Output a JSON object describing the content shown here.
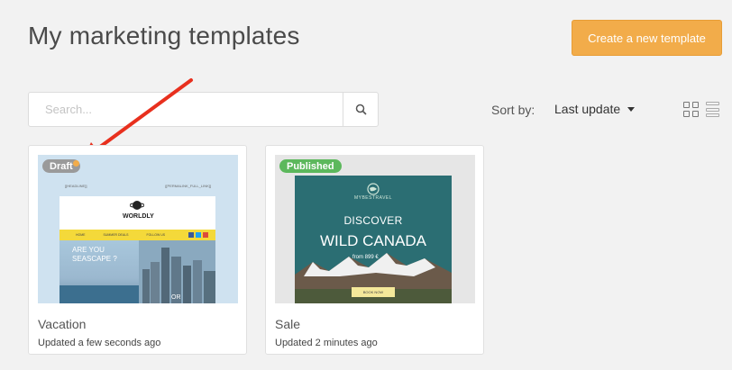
{
  "page": {
    "title": "My marketing templates"
  },
  "toolbar": {
    "create_label": "Create a new template"
  },
  "search": {
    "placeholder": "Search..."
  },
  "sort": {
    "label": "Sort by:",
    "value": "Last update"
  },
  "colors": {
    "accent": "#f2ac4a",
    "draft": "#9a9a9a",
    "published": "#5cb85c"
  },
  "templates": [
    {
      "name": "Vacation",
      "updated": "Updated a few seconds ago",
      "status": "Draft",
      "thumb": {
        "header_left": "[[HEADLINE]]",
        "header_right": "[[PERMALINK_FULL_LINK]]",
        "logo": "WORLDLY",
        "nav": [
          "HOME",
          "SUMMER DEALS",
          "FOLLOW US"
        ],
        "hero_line1": "ARE YOU",
        "hero_line2": "SEASCAPE ?",
        "hero_side": "OR"
      }
    },
    {
      "name": "Sale",
      "updated": "Updated 2 minutes ago",
      "status": "Published",
      "thumb": {
        "brand": "MYBESTRAVEL",
        "headline1": "DISCOVER",
        "headline2": "WILD CANADA",
        "price": "from 899 €",
        "button": "BOOK NOW"
      }
    }
  ]
}
